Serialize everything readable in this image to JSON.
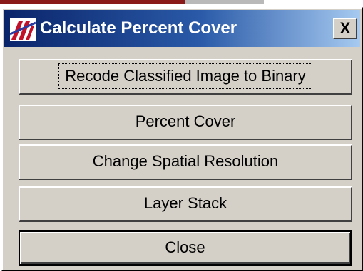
{
  "window": {
    "title": "Calculate Percent Cover",
    "close_glyph": "X",
    "app_icon": "app-logo-icon",
    "title_gradient": [
      "#0a246a",
      "#a6caf0"
    ]
  },
  "buttons": [
    {
      "label": "Recode Classified Image to Binary",
      "state": "focused"
    },
    {
      "label": "Percent Cover"
    },
    {
      "label": "Change Spatial Resolution"
    },
    {
      "label": "Layer Stack"
    },
    {
      "label": "Close",
      "state": "default"
    }
  ],
  "colors": {
    "face": "#d4d0c8",
    "title_text": "#ffffff"
  }
}
